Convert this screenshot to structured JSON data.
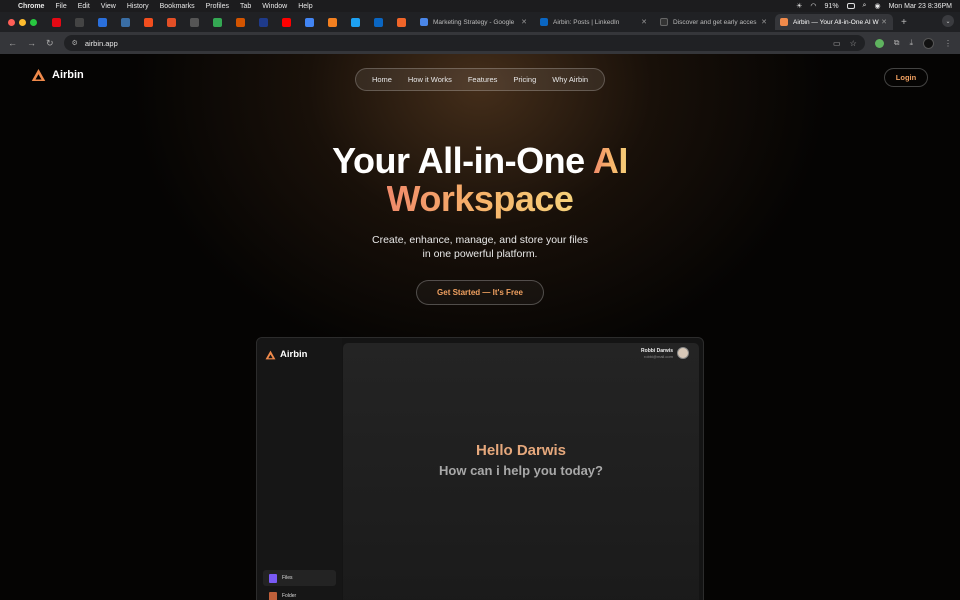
{
  "menubar": {
    "app": "Chrome",
    "items": [
      "File",
      "Edit",
      "View",
      "History",
      "Bookmarks",
      "Profiles",
      "Tab",
      "Window",
      "Help"
    ],
    "battery": "91%",
    "datetime": "Mon Mar 23  8:36PM"
  },
  "tabs": [
    {
      "title": "Marketing Strategy - Google",
      "color": "#4a86e8"
    },
    {
      "title": "Airbin: Posts | LinkedIn",
      "color": "#0a66c2"
    },
    {
      "title": "Discover and get early acces",
      "color": "#222"
    },
    {
      "title": "Airbin — Your All-in-One AI W",
      "color": "#f08a4b",
      "active": true
    }
  ],
  "pinned_colors": [
    "#e50914",
    "#444",
    "#2a6fdb",
    "#3a6ea5",
    "#f24e1e",
    "#e34f26",
    "#555",
    "#34a853",
    "#d35400",
    "#1e3a8a",
    "#ff0000",
    "#4285f4",
    "#f38020",
    "#1da1f2",
    "#0a66c2",
    "#f06529"
  ],
  "address": {
    "url": "airbin.app"
  },
  "site": {
    "brand": "Airbin",
    "nav": [
      "Home",
      "How it Works",
      "Features",
      "Pricing",
      "Why Airbin"
    ],
    "login": "Login",
    "hero_line1": "Your All-in-One ",
    "hero_accent1": "AI",
    "hero_accent2": "Workspace",
    "sub_line1": "Create, enhance, manage, and store your files",
    "sub_line2": "in one powerful platform.",
    "cta": "Get Started — It's Free"
  },
  "preview": {
    "brand": "Airbin",
    "user_name": "Robbi Darwis",
    "user_email": "robbi@mail.com",
    "greeting": "Hello Darwis",
    "prompt": "How can i help you today?",
    "sidebar": [
      {
        "label": "Files",
        "color": "#7a5af5"
      },
      {
        "label": "Folder",
        "color": "#c0603a"
      }
    ]
  }
}
